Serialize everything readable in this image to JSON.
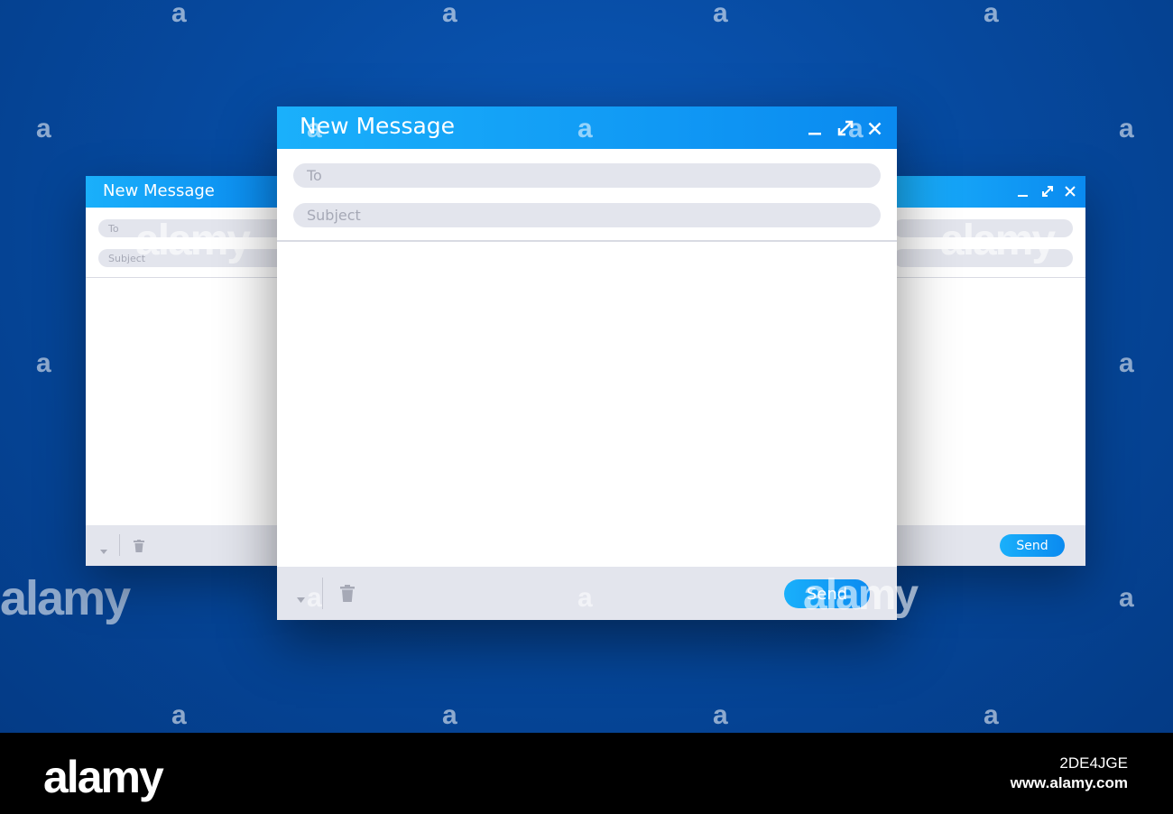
{
  "watermark": {
    "letter": "a",
    "brand": "alamy"
  },
  "main_window": {
    "title": "New Message",
    "to_placeholder": "To",
    "subject_placeholder": "Subject",
    "send_label": "Send"
  },
  "back_left_window": {
    "title": "New Message",
    "to_placeholder": "To",
    "subject_placeholder": "Subject"
  },
  "back_right_window": {
    "send_label": "Send"
  },
  "icons": [
    "minimize-icon",
    "expand-icon",
    "close-icon",
    "dropdown-arrow-icon",
    "trash-icon"
  ],
  "colors": {
    "accent_start": "#1ab0fb",
    "accent_end": "#0a8af0",
    "background": "#064aa0",
    "field": "#e3e5ed"
  },
  "footer_bar": {
    "image_id": "2DE4JGE",
    "website": "www.alamy.com",
    "brand": "alamy"
  }
}
